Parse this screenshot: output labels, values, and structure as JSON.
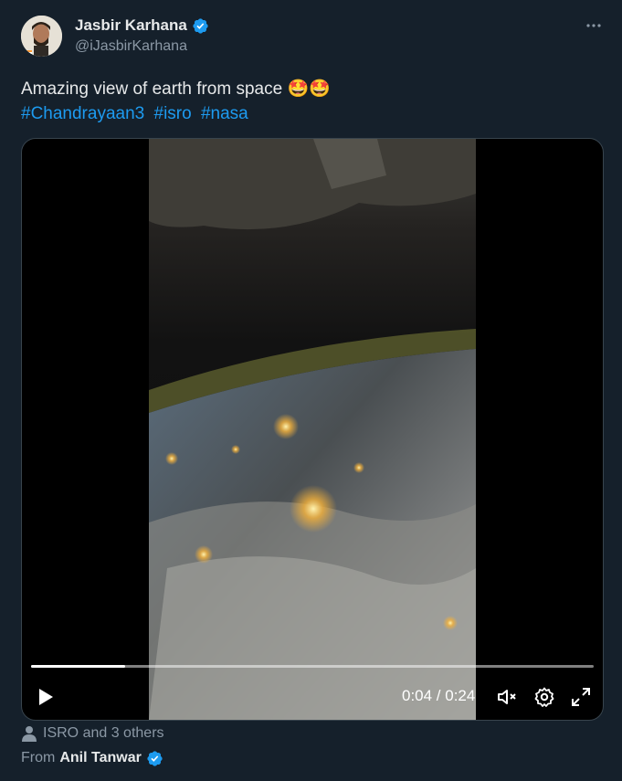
{
  "author": {
    "name": "Jasbir Karhana",
    "handle": "@iJasbirKarhana",
    "verified_color": "#1d9bf0"
  },
  "tweet": {
    "text": "Amazing view of earth from space 🤩🤩",
    "hashtags": [
      "#Chandrayaan3",
      "#isro",
      "#nasa"
    ]
  },
  "video": {
    "current_time": "0:04",
    "duration": "0:24",
    "time_display": "0:04 / 0:24",
    "progress": 0.167
  },
  "tagged": {
    "icon": "person-icon",
    "text": "ISRO and 3 others"
  },
  "source": {
    "prefix": "From",
    "name": "Anil Tanwar"
  },
  "icons": {
    "more": "more-dots-icon",
    "play": "play-icon",
    "mute": "muted-speaker-icon",
    "settings": "gear-icon",
    "fullscreen": "fullscreen-icon"
  }
}
